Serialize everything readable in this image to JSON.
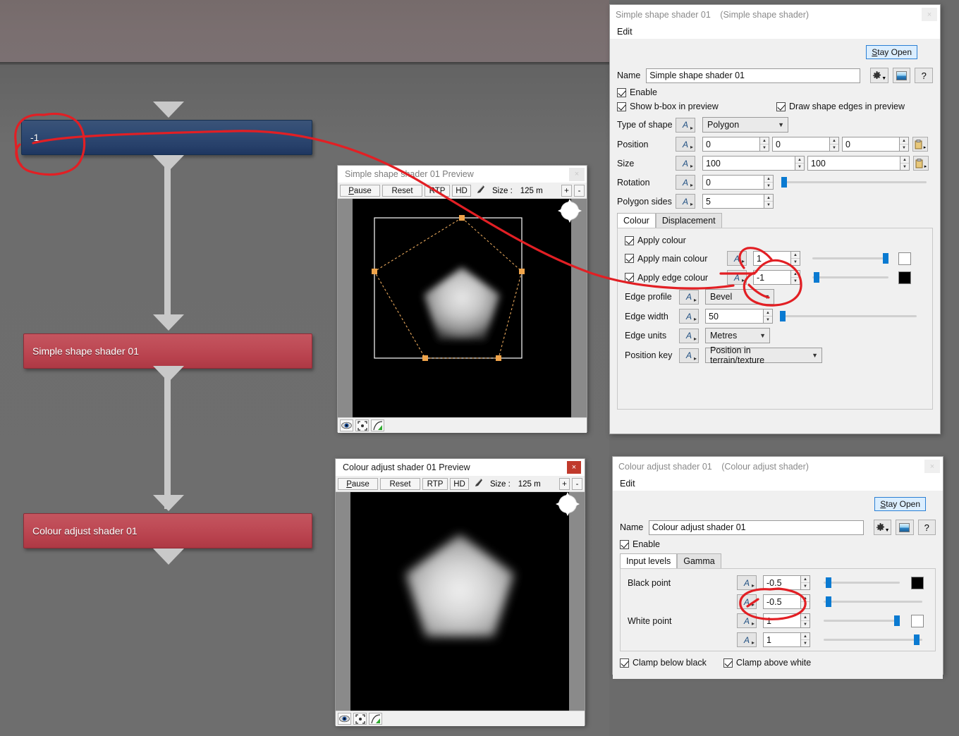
{
  "node_graph": {
    "nodes": [
      {
        "label": "-1",
        "kind": "blue"
      },
      {
        "label": "Simple shape shader 01",
        "kind": "red"
      },
      {
        "label": "Colour adjust shader 01",
        "kind": "red"
      }
    ]
  },
  "preview_shape": {
    "title_name": "Simple shape shader 01",
    "title_suffix": " Preview",
    "close_label": "×",
    "toolbar": {
      "pause": "Pause",
      "pause_accel": "P",
      "reset": "Reset",
      "rtp": "RTP",
      "hd": "HD",
      "size_label": "Size :",
      "size_value": "125 m",
      "plus": "+",
      "minus": "-"
    },
    "footer_icons": [
      "eye-icon",
      "fit-icon",
      "curve-icon"
    ]
  },
  "preview_colour": {
    "title_name": "Colour adjust shader 01",
    "title_suffix": " Preview",
    "close_label": "×",
    "toolbar": {
      "pause": "Pause",
      "pause_accel": "P",
      "reset": "Reset",
      "rtp": "RTP",
      "hd": "HD",
      "size_label": "Size :",
      "size_value": "125 m",
      "plus": "+",
      "minus": "-"
    },
    "footer_icons": [
      "eye-icon",
      "fit-icon",
      "curve-icon"
    ]
  },
  "panel_shape": {
    "title": "Simple shape shader 01",
    "title_type": "(Simple shape shader)",
    "close_label": "×",
    "menu_edit": "Edit",
    "stay_open": "Stay Open",
    "stay_open_accel": "S",
    "stay_open_rest": "tay Open",
    "name_label": "Name",
    "name_value": "Simple shape shader 01",
    "help_label": "?",
    "enable_label": "Enable",
    "show_bbox_label": "Show b-box in preview",
    "draw_edges_label": "Draw shape edges in preview",
    "type_of_shape_label": "Type of shape",
    "type_of_shape_value": "Polygon",
    "position_label": "Position",
    "position_values": [
      "0",
      "0",
      "0"
    ],
    "size_label": "Size",
    "size_values": [
      "100",
      "100"
    ],
    "rotation_label": "Rotation",
    "rotation_value": "0",
    "polygon_sides_label": "Polygon sides",
    "polygon_sides_value": "5",
    "tabs": [
      {
        "label": "Colour",
        "active": true
      },
      {
        "label": "Displacement",
        "active": false
      }
    ],
    "apply_colour_label": "Apply colour",
    "apply_main_colour_label": "Apply main colour",
    "apply_main_colour_value": "1",
    "apply_main_colour_swatch": "#ffffff",
    "apply_edge_colour_label": "Apply edge colour",
    "apply_edge_colour_value": "-1",
    "apply_edge_colour_swatch": "#000000",
    "edge_profile_label": "Edge profile",
    "edge_profile_value": "Bevel",
    "edge_width_label": "Edge width",
    "edge_width_value": "50",
    "edge_units_label": "Edge units",
    "edge_units_value": "Metres",
    "position_key_label": "Position key",
    "position_key_value": "Position in terrain/texture"
  },
  "panel_colour": {
    "title": "Colour adjust shader 01",
    "title_type": "(Colour adjust shader)",
    "close_label": "×",
    "menu_edit": "Edit",
    "stay_open_accel": "S",
    "stay_open_rest": "tay Open",
    "name_label": "Name",
    "name_value": "Colour adjust shader 01",
    "help_label": "?",
    "enable_label": "Enable",
    "tabs": [
      {
        "label": "Input levels",
        "active": true
      },
      {
        "label": "Gamma",
        "active": false
      }
    ],
    "black_point_label": "Black point",
    "black_point_value_1": "-0.5",
    "black_point_value_2": "-0.5",
    "black_point_swatch": "#000000",
    "white_point_label": "White point",
    "white_point_value_1": "1",
    "white_point_value_2": "1",
    "white_point_swatch": "#ffffff",
    "clamp_below_black_label": "Clamp below black",
    "clamp_above_white_label": "Clamp above white"
  },
  "annotation": {
    "colour": "#e21f24",
    "description": "Red hand-drawn circles around node value -1, edge colour value -1, and black point -0.5, plus a connector line"
  }
}
